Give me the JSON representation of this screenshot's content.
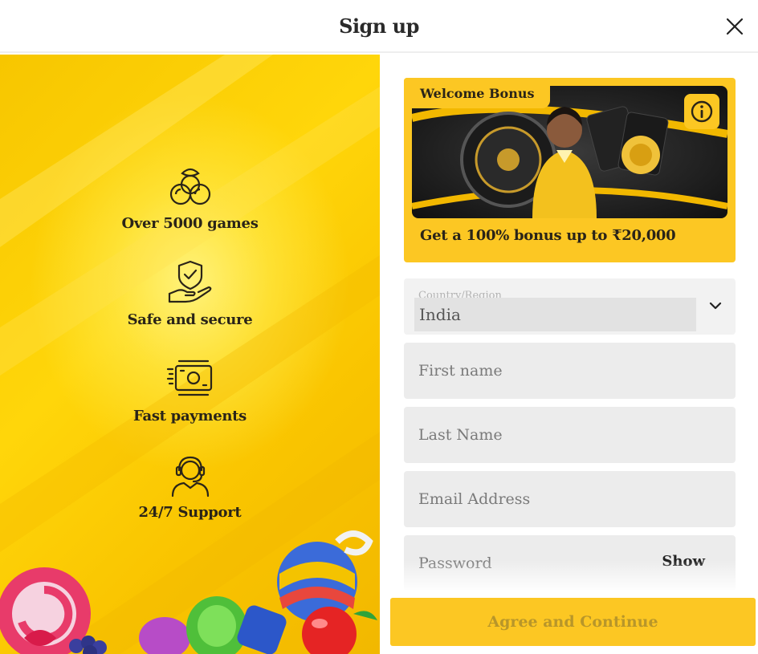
{
  "header": {
    "title": "Sign up"
  },
  "features": [
    {
      "icon": "cherries-icon",
      "label": "Over 5000 games"
    },
    {
      "icon": "shield-hand-icon",
      "label": "Safe and secure"
    },
    {
      "icon": "cash-payment-icon",
      "label": "Fast payments"
    },
    {
      "icon": "headset-support-icon",
      "label": "24/7 Support"
    }
  ],
  "bonus": {
    "tab_label": "Welcome Bonus",
    "text": "Get a 100% bonus up to ₹20,000"
  },
  "form": {
    "country_label": "Country/Region",
    "country_value": "India",
    "first_name_placeholder": "First name",
    "last_name_placeholder": "Last Name",
    "email_placeholder": "Email Address",
    "password_placeholder": "Password",
    "show_label": "Show"
  },
  "cta": {
    "agree_label": "Agree and Continue"
  },
  "colors": {
    "accent": "#fcc723",
    "field_bg": "#ececec"
  }
}
